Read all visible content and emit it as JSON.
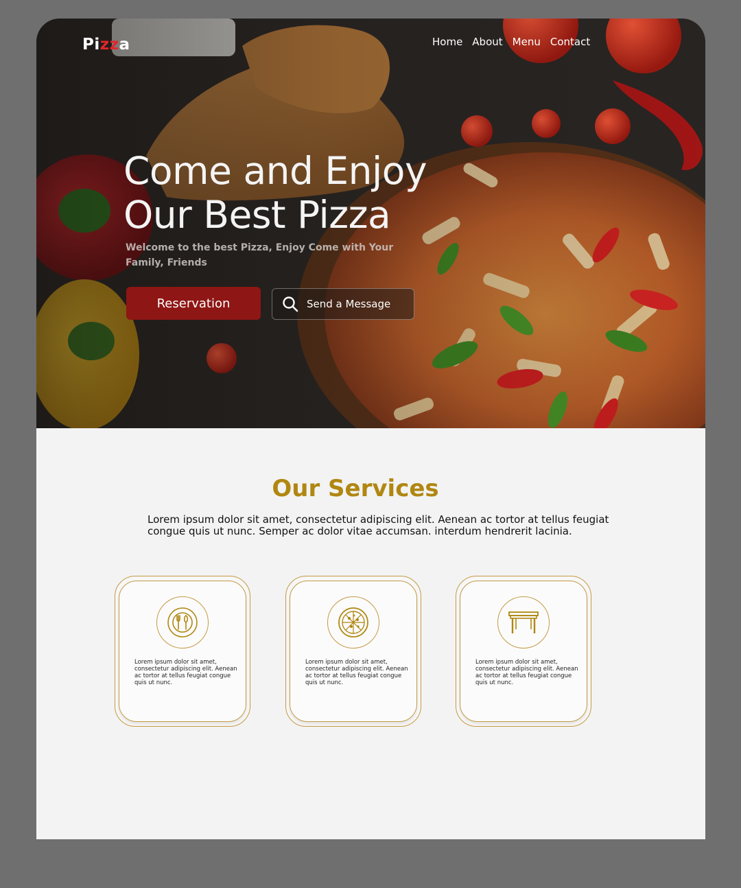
{
  "brand": {
    "logo_prefix": "Pi",
    "logo_accent": "zz",
    "logo_suffix": "a"
  },
  "nav": {
    "items": [
      "Home",
      "About",
      "Menu",
      "Contact"
    ]
  },
  "hero": {
    "title_line1": "Come and Enjoy",
    "title_line2": "Our Best Pizza",
    "subtitle": "Welcome to the best Pizza, Enjoy Come with Your Family, Friends",
    "reservation_label": "Reservation",
    "message_label": "Send a Message",
    "message_icon": "search-icon"
  },
  "services": {
    "title": "Our Services",
    "description": "Lorem ipsum dolor sit amet, consectetur adipiscing elit. Aenean ac tortor at tellus feugiat congue quis ut nunc. Semper ac dolor vitae accumsan. interdum hendrerit lacinia.",
    "cards": [
      {
        "icon": "plate-cutlery-icon",
        "text": "Lorem ipsum dolor sit amet, consectetur adipiscing elit. Aenean ac tortor at tellus feugiat congue quis ut nunc."
      },
      {
        "icon": "pizza-icon",
        "text": "Lorem ipsum dolor sit amet, consectetur adipiscing elit. Aenean ac tortor at tellus feugiat congue quis ut nunc."
      },
      {
        "icon": "table-icon",
        "text": "Lorem ipsum dolor sit amet, consectetur adipiscing elit. Aenean ac tortor at tellus feugiat congue quis ut nunc."
      }
    ]
  },
  "colors": {
    "accent_gold": "#b08712",
    "brand_red": "#8e1614",
    "logo_red": "#e0262a",
    "background_gray": "#6f6f70"
  }
}
